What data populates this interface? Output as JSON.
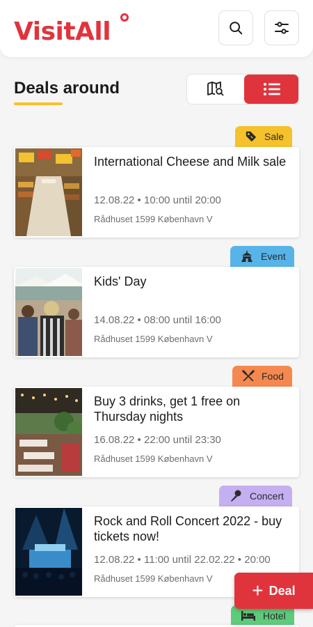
{
  "app": {
    "name": "VisitAll"
  },
  "header": {
    "search_icon": "search-icon",
    "filter_icon": "sliders-icon"
  },
  "section": {
    "title": "Deals around"
  },
  "view_toggle": {
    "map_icon": "map-search-icon",
    "list_icon": "list-icon",
    "active": "list"
  },
  "colors": {
    "brand_red": "#e0343d",
    "underline_yellow": "#f5c22b",
    "sale": "#f5c22b",
    "event": "#56b4e9",
    "food": "#f4884f",
    "concert": "#c4aff0",
    "hotel": "#5ecb7a"
  },
  "deals": [
    {
      "badge": "Sale",
      "badge_icon": "tag-icon",
      "title": "International Cheese and Milk sale",
      "date": "12.08.22 • 10:00 until 20:00",
      "address": "Rådhuset 1599 København V",
      "image": "supermarket-aisle"
    },
    {
      "badge": "Event",
      "badge_icon": "tent-icon",
      "title": "Kids' Day",
      "date": "14.08.22 • 08:00 until 16:00",
      "address": "Rådhuset 1599 København V",
      "image": "crowd-outdoors"
    },
    {
      "badge": "Food",
      "badge_icon": "fork-knife-icon",
      "title": "Buy 3 drinks, get 1 free on Thursday nights",
      "date": "16.08.22 • 22:00 until 23:30",
      "address": "Rådhuset 1599 København V",
      "image": "restaurant-terrace"
    },
    {
      "badge": "Concert",
      "badge_icon": "microphone-icon",
      "title": "Rock and Roll Concert 2022 - buy tickets now!",
      "date": "12.08.22 • 11:00 until 22.02.22 • 20:00",
      "address": "Rådhuset 1599 København V",
      "image": "concert-stage"
    },
    {
      "badge": "Hotel",
      "badge_icon": "bed-icon"
    }
  ],
  "fab": {
    "label": "Deal",
    "icon": "plus-icon"
  }
}
